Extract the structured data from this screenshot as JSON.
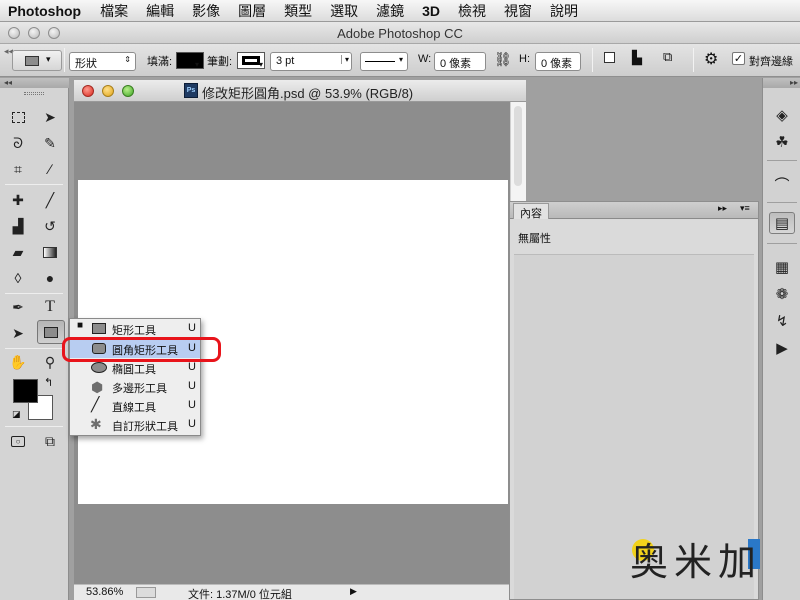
{
  "menubar": {
    "app": "Photoshop",
    "items": [
      "檔案",
      "編輯",
      "影像",
      "圖層",
      "類型",
      "選取",
      "濾鏡",
      "3D",
      "檢視",
      "視窗",
      "說明"
    ]
  },
  "window": {
    "title": "Adobe Photoshop CC"
  },
  "options": {
    "mode": "形狀",
    "fill_label": "填滿:",
    "stroke_label": "筆劃:",
    "stroke_width": "3 pt",
    "w_label": "W:",
    "w_value": "0 像素",
    "h_label": "H:",
    "h_value": "0 像素",
    "align_edges_label": "對齊邊緣",
    "align_edges_checked": true
  },
  "document": {
    "title": "修改矩形圓角.psd @ 53.9% (RGB/8)",
    "zoom": "53.86%",
    "status": "文件: 1.37M/0 位元組"
  },
  "flyout": {
    "items": [
      {
        "label": "矩形工具",
        "key": "U",
        "icon": "rectangle-icon",
        "current": true
      },
      {
        "label": "圓角矩形工具",
        "key": "U",
        "icon": "rounded-rectangle-icon",
        "highlighted": true
      },
      {
        "label": "橢圓工具",
        "key": "U",
        "icon": "ellipse-icon"
      },
      {
        "label": "多邊形工具",
        "key": "U",
        "icon": "polygon-icon"
      },
      {
        "label": "直線工具",
        "key": "U",
        "icon": "line-icon"
      },
      {
        "label": "自訂形狀工具",
        "key": "U",
        "icon": "custom-shape-icon"
      }
    ]
  },
  "properties": {
    "tab": "內容",
    "content": "無屬性"
  },
  "watermark": {
    "text": "奥米加"
  },
  "colors": {
    "highlight": "#b8cdf1",
    "callout": "#e8141b",
    "foreground": "#000000",
    "background": "#ffffff"
  }
}
